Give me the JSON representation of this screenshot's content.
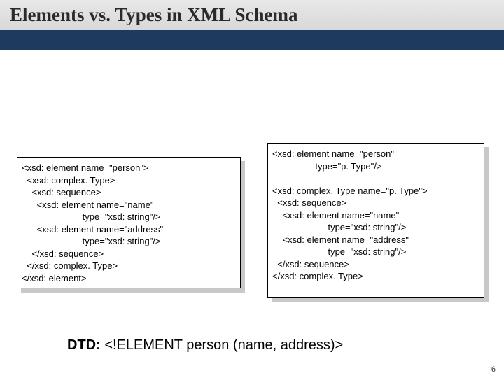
{
  "title": "Elements vs. Types in XML Schema",
  "left_code": "<xsd: element name=\"person\">\n  <xsd: complex. Type>\n    <xsd: sequence>\n      <xsd: element name=\"name\"\n                        type=\"xsd: string\"/>\n      <xsd: element name=\"address\"\n                        type=\"xsd: string\"/>\n    </xsd: sequence>\n  </xsd: complex. Type>\n</xsd: element>",
  "right_code": "<xsd: element name=\"person\"\n                 type=\"p. Type\"/>\n\n<xsd: complex. Type name=\"p. Type\">\n  <xsd: sequence>\n    <xsd: element name=\"name\"\n                      type=\"xsd: string\"/>\n    <xsd: element name=\"address\"\n                      type=\"xsd: string\"/>\n  </xsd: sequence>\n</xsd: complex. Type>",
  "dtd_label": "DTD:",
  "dtd_value": " <!ELEMENT person (name, address)>",
  "slide_number": "6"
}
